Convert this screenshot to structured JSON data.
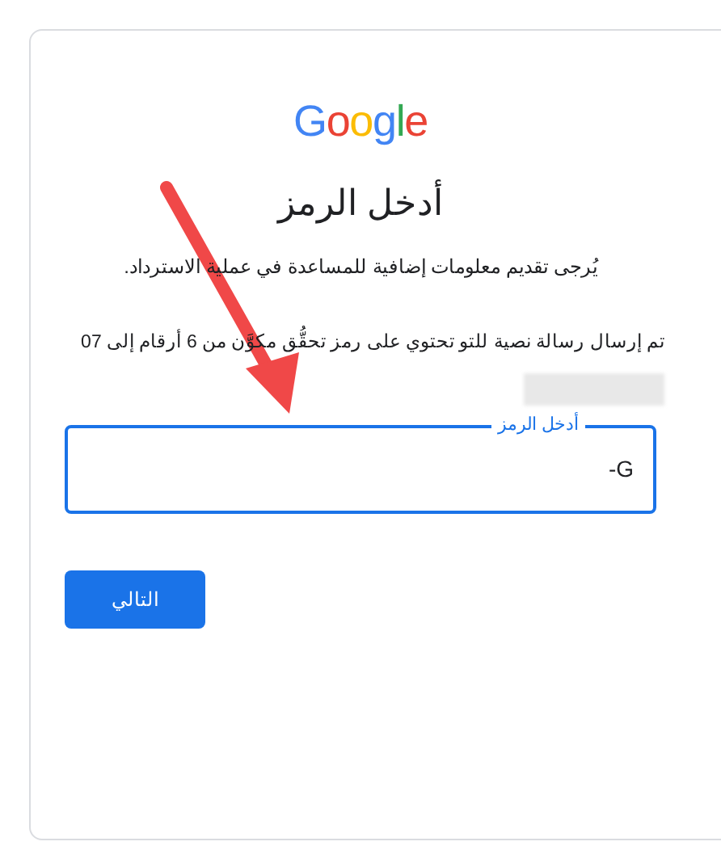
{
  "logo": "Google",
  "title": "أدخل الرمز",
  "subtitle": "يُرجى تقديم معلومات إضافية للمساعدة في عملية الاسترداد.",
  "message": "تم إرسال رسالة نصية للتو تحتوي على رمز تحقُّق مكوَّن من 6 أرقام إلى 07",
  "code_field": {
    "label": "أدخل الرمز",
    "value": "G-",
    "focused": true
  },
  "next_button": "التالي"
}
